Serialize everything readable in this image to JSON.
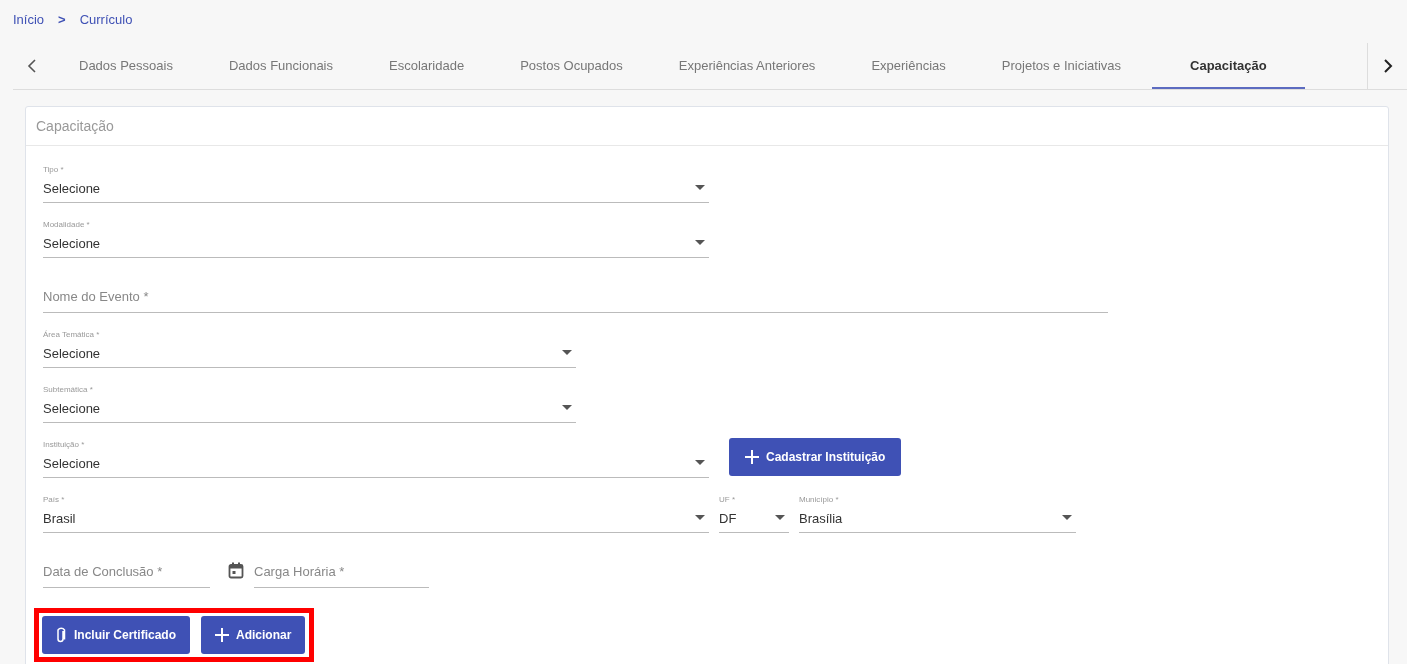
{
  "breadcrumb": [
    {
      "label": "Início"
    },
    {
      "label": "Currículo"
    }
  ],
  "breadcrumb_separator": ">",
  "tabs": [
    {
      "label": "Dados Pessoais",
      "selected": false
    },
    {
      "label": "Dados Funcionais",
      "selected": false
    },
    {
      "label": "Escolaridade",
      "selected": false
    },
    {
      "label": "Postos Ocupados",
      "selected": false
    },
    {
      "label": "Experiências Anteriores",
      "selected": false
    },
    {
      "label": "Experiências",
      "selected": false
    },
    {
      "label": "Projetos e Iniciativas",
      "selected": false
    },
    {
      "label": "Capacitação",
      "selected": true
    }
  ],
  "card": {
    "title": "Capacitação",
    "rows": [
      [
        {
          "kind": "select",
          "label": "Tipo *",
          "value": "Selecione"
        }
      ],
      [
        {
          "kind": "select",
          "label": "Modalidade *",
          "value": "Selecione"
        }
      ],
      [
        {
          "kind": "text",
          "placeholder": "Nome do Evento *"
        }
      ],
      [
        {
          "kind": "select",
          "label": "Área Temática *",
          "value": "Selecione"
        }
      ],
      [
        {
          "kind": "select",
          "label": "Subtemática *",
          "value": "Selecione"
        }
      ],
      [
        {
          "kind": "select",
          "label": "Instituição *",
          "value": "Selecione",
          "action": {
            "label": "Cadastrar Instituição"
          }
        }
      ],
      [
        {
          "kind": "select",
          "label": "País *",
          "value": "Brasil"
        },
        {
          "kind": "select",
          "label": "UF *",
          "value": "DF"
        },
        {
          "kind": "select",
          "label": "Município *",
          "value": "Brasília"
        }
      ],
      [
        {
          "kind": "date",
          "placeholder": "Data de Conclusão *"
        },
        {
          "kind": "text",
          "placeholder": "Carga Horária *"
        }
      ]
    ],
    "actions": [
      {
        "kind": "attach",
        "label": "Incluir Certificado"
      },
      {
        "kind": "add",
        "label": "Adicionar"
      }
    ]
  }
}
